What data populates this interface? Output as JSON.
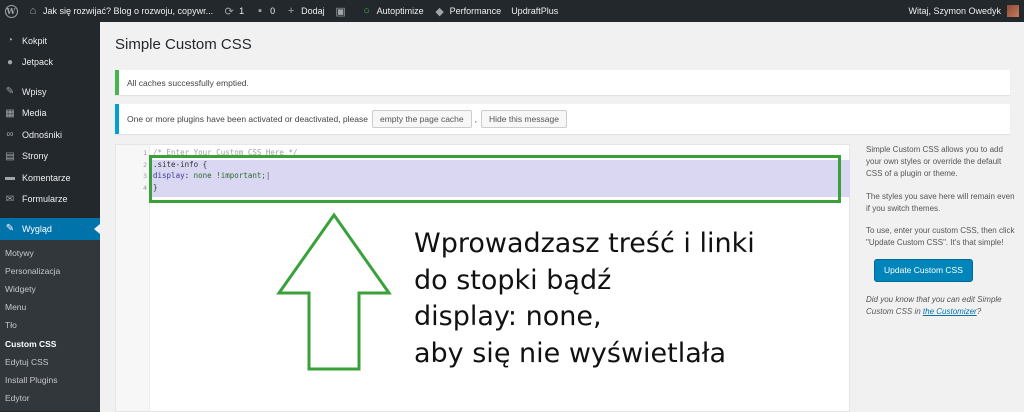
{
  "admin_bar": {
    "site_title": "Jak się rozwijać? Blog o rozwoju, copywr...",
    "updates_count": "1",
    "comments_count": "0",
    "add_new": "Dodaj",
    "autoptimize": "Autoptimize",
    "performance": "Performance",
    "updraftplus": "UpdraftPlus",
    "greeting": "Witaj, Szymon Owedyk"
  },
  "menu": {
    "items": [
      {
        "label": "Kokpit",
        "icon": "dashboard-icon"
      },
      {
        "label": "Jetpack",
        "icon": "jetpack-icon"
      },
      {
        "label": "Wpisy",
        "icon": "pin-icon"
      },
      {
        "label": "Media",
        "icon": "media-icon"
      },
      {
        "label": "Odnośniki",
        "icon": "link-icon"
      },
      {
        "label": "Strony",
        "icon": "pages-icon"
      },
      {
        "label": "Komentarze",
        "icon": "comment-icon"
      },
      {
        "label": "Formularze",
        "icon": "forms-icon"
      },
      {
        "label": "Wygląd",
        "icon": "appearance-icon"
      }
    ],
    "submenu": [
      {
        "label": "Motywy"
      },
      {
        "label": "Personalizacja"
      },
      {
        "label": "Widgety"
      },
      {
        "label": "Menu"
      },
      {
        "label": "Tło"
      },
      {
        "label": "Custom CSS"
      },
      {
        "label": "Edytuj CSS"
      },
      {
        "label": "Install Plugins"
      },
      {
        "label": "Edytor"
      }
    ]
  },
  "page": {
    "title": "Simple Custom CSS"
  },
  "notices": {
    "cache_emptied": "All caches successfully emptied.",
    "plugins_changed": "One or more plugins have been activated or deactivated, please",
    "empty_cache_button": "empty the page cache",
    "comma": ",",
    "hide_button": "Hide this message"
  },
  "editor": {
    "lines": [
      {
        "num": "1",
        "text": "/* Enter Your Custom CSS Here */"
      },
      {
        "num": "2",
        "text": ".site-info {"
      },
      {
        "num": "3",
        "prop": "display",
        "value": " none !important;"
      },
      {
        "num": "4",
        "text": "}"
      }
    ]
  },
  "sidebar": {
    "intro": "Simple Custom CSS allows you to add your own styles or override the default CSS of a plugin or theme.",
    "persist": "The styles you save here will remain even if you switch themes.",
    "usage": "To use, enter your custom CSS, then click \"Update Custom CSS\". It's that simple!",
    "update_button": "Update Custom CSS",
    "customizer_note": "Did you know that you can edit Simple Custom CSS in",
    "customizer_link": "the Customizer",
    "question_mark": "?"
  },
  "annotation": {
    "lines": [
      "Wprowadzasz treść i linki",
      "do stopki bądź",
      "display: none,",
      "aby się nie wyświetlała"
    ],
    "arrow_color": "#3aa13a"
  }
}
